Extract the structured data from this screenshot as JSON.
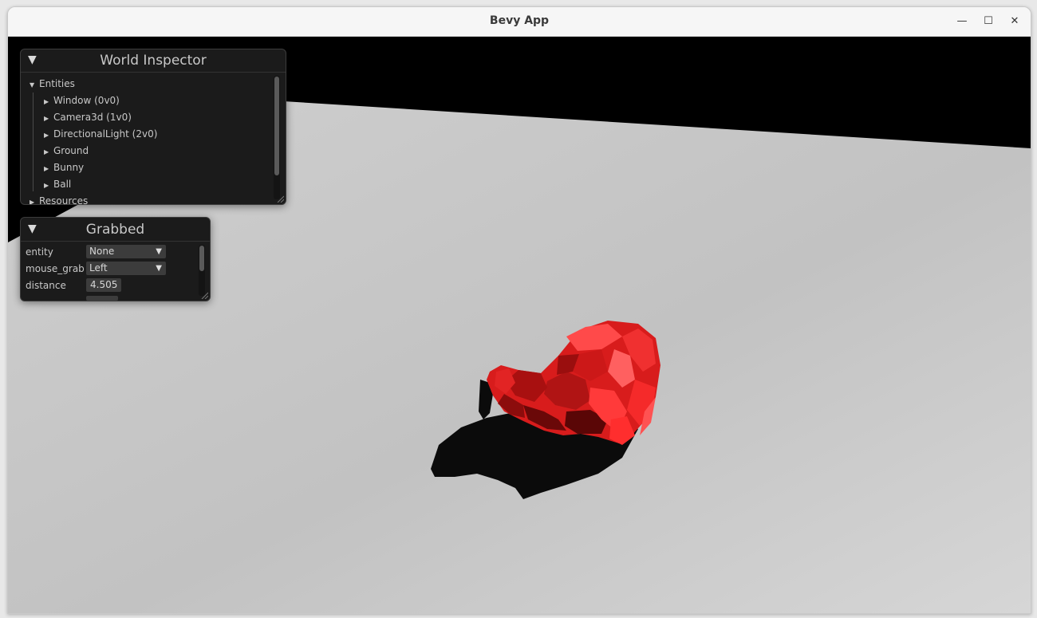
{
  "window": {
    "title": "Bevy App",
    "controls": {
      "minimize": "—",
      "maximize": "☐",
      "close": "✕"
    }
  },
  "world_inspector": {
    "title": "World Inspector",
    "collapse_glyph": "▼",
    "entities_label": "Entities",
    "entities": [
      "Window (0v0)",
      "Camera3d (1v0)",
      "DirectionalLight (2v0)",
      "Ground",
      "Bunny",
      "Ball"
    ],
    "resources_label": "Resources"
  },
  "grabbed": {
    "title": "Grabbed",
    "collapse_glyph": "▼",
    "fields": {
      "entity": {
        "label": "entity",
        "value": "None"
      },
      "mouse_grab": {
        "label": "mouse_grab",
        "value": "Left"
      },
      "distance": {
        "label": "distance",
        "value": "4.505"
      }
    }
  },
  "colors": {
    "sky": "#000000",
    "ground": "#c4c4c4",
    "bunny": "#e41e1e",
    "panel_bg": "#1b1b1b"
  }
}
